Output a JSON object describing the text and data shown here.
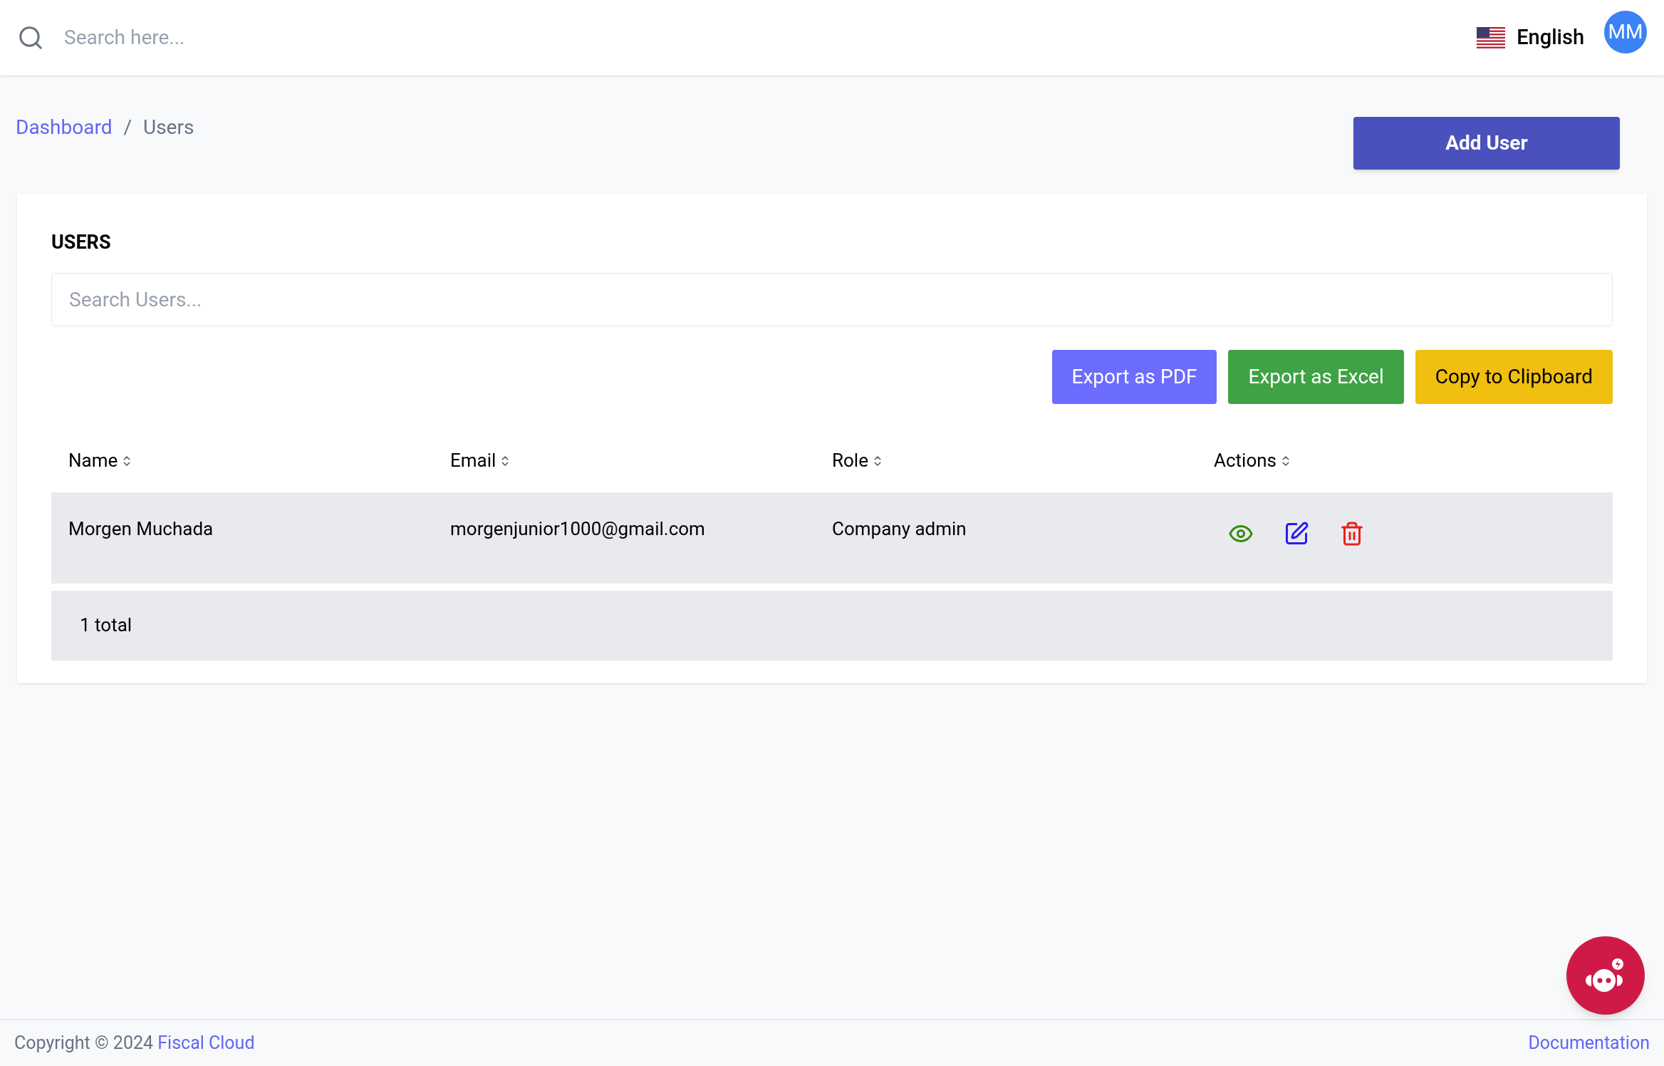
{
  "header": {
    "search": {
      "placeholder": "Search here..."
    },
    "language": "English",
    "avatar": "MM"
  },
  "breadcrumb": [
    {
      "label": "Dashboard",
      "kind": "link"
    },
    {
      "label": "/",
      "kind": "separator"
    },
    {
      "label": "Users",
      "kind": "current"
    }
  ],
  "add_button": "Add User",
  "card": {
    "title": "USERS",
    "search": {
      "placeholder": "Search Users..."
    },
    "export_buttons": [
      {
        "label": "Export as PDF",
        "color": "#6c6cff"
      },
      {
        "label": "Export as Excel",
        "color": "#3fa244"
      },
      {
        "label": "Copy to Clipboard",
        "color": "#f0bf0f"
      }
    ],
    "table": {
      "columns": [
        "Name",
        "Email",
        "Role",
        "Actions"
      ],
      "rows": [
        {
          "name": "Morgen Muchada",
          "email": "morgenjunior1000@gmail.com",
          "role": "Company admin"
        }
      ],
      "total": "1 total"
    }
  },
  "footer": {
    "copyright": "Copyright © 2024",
    "brand": "Fiscal Cloud",
    "link": "Documentation"
  }
}
